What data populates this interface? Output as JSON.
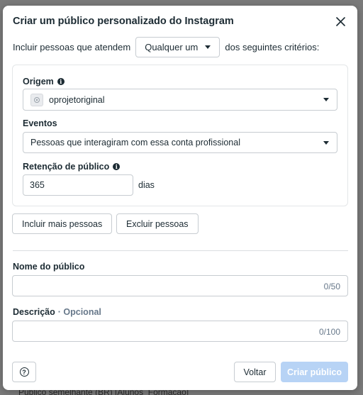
{
  "backdrop": {
    "text": "Público semelhante (BR) [Alunos_Formação]"
  },
  "modal": {
    "title": "Criar um público personalizado do Instagram",
    "include_prefix": "Incluir pessoas que atendem",
    "include_select": "Qualquer um",
    "include_suffix": "dos seguintes critérios:",
    "source": {
      "label": "Origem",
      "value": "oprojetoriginal"
    },
    "events": {
      "label": "Eventos",
      "value": "Pessoas que interagiram com essa conta profissional"
    },
    "retention": {
      "label": "Retenção de público",
      "value": "365",
      "unit": "dias"
    },
    "include_more_button": "Incluir mais pessoas",
    "exclude_button": "Excluir pessoas",
    "audience_name": {
      "label": "Nome do público",
      "counter": "0/50",
      "value": ""
    },
    "description": {
      "label": "Descrição",
      "optional": "· Opcional",
      "counter": "0/100",
      "value": ""
    },
    "back_button": "Voltar",
    "create_button": "Criar público"
  },
  "colors": {
    "primary_disabled": "#b7d3f5",
    "text": "#1c2b33",
    "border": "#c7ccd1"
  },
  "icons": {
    "close": "close-icon",
    "info": "info-icon",
    "help": "help-icon",
    "caret": "chevron-down-icon"
  }
}
